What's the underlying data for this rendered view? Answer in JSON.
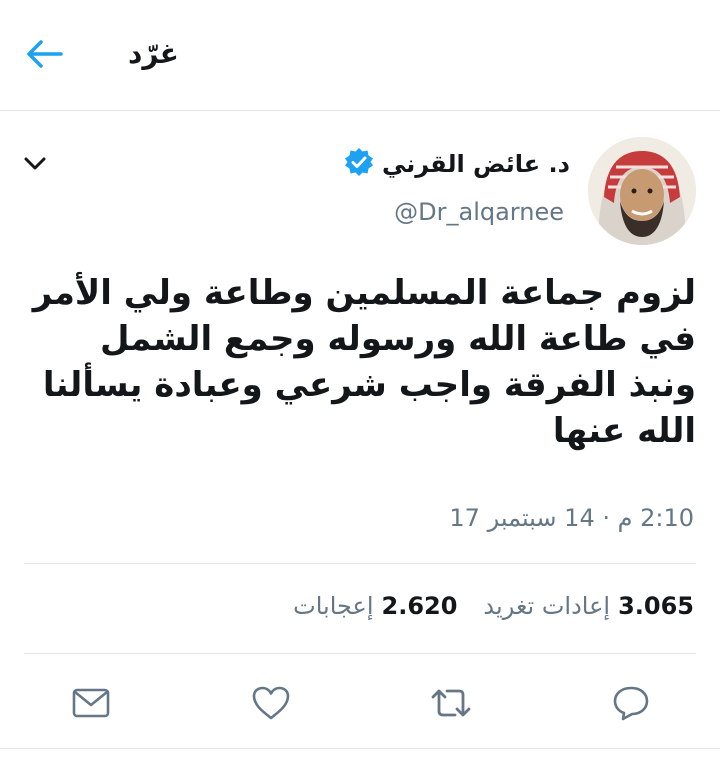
{
  "header": {
    "title": "غرّد",
    "back_icon": "arrow-left-icon",
    "accent": "#1da1f2"
  },
  "tweet": {
    "author_name": "د. عائض القرني",
    "verified_icon": "verified-badge-icon",
    "handle": "@Dr_alqarnee",
    "menu_icon": "chevron-down-icon",
    "text": "لزوم جماعة المسلمين وطاعة ولي الأمر في طاعة الله ورسوله وجمع الشمل ونبذ الفرقة واجب شرعي وعبادة يسألنا الله عنها",
    "timestamp": "2:10 م · 14 سبتمبر 17"
  },
  "stats": {
    "retweets_count": "3.065",
    "retweets_label": "إعادات تغريد",
    "likes_count": "2.620",
    "likes_label": "إعجابات"
  },
  "actions": [
    "reply-icon",
    "retweet-icon",
    "like-icon",
    "message-icon"
  ],
  "colors": {
    "text": "#14171a",
    "secondary": "#657786",
    "divider": "#e1e8ed",
    "accent": "#1da1f2"
  }
}
